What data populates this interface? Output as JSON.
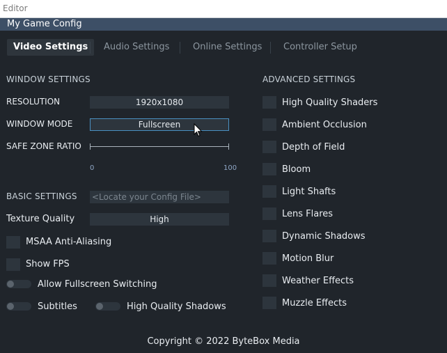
{
  "os_window": {
    "title": "Editor"
  },
  "app": {
    "title": "My Game Config"
  },
  "tabs": [
    {
      "label": "Video Settings",
      "active": true
    },
    {
      "label": "Audio Settings",
      "active": false
    },
    {
      "label": "Online Settings",
      "active": false
    },
    {
      "label": "Controller Setup",
      "active": false
    }
  ],
  "window_settings": {
    "title": "WINDOW SETTINGS",
    "resolution": {
      "label": "RESOLUTION",
      "value": "1920x1080"
    },
    "window_mode": {
      "label": "WINDOW MODE",
      "value": "Fullscreen"
    },
    "safe_zone": {
      "label": "SAFE ZONE RATIO",
      "min": "0",
      "max": "100"
    }
  },
  "basic_settings": {
    "title": "BASIC SETTINGS",
    "config_path_placeholder": "<Locate your Config File>",
    "texture_quality": {
      "label": "Texture Quality",
      "value": "High"
    },
    "checkboxes": [
      {
        "label": "MSAA Anti-Aliasing",
        "checked": false
      },
      {
        "label": "Show FPS",
        "checked": false
      }
    ],
    "toggles": [
      {
        "label": "Allow Fullscreen Switching",
        "on": false
      },
      {
        "label": "Subtitles",
        "on": false
      },
      {
        "label": "High Quality Shadows",
        "on": false
      }
    ]
  },
  "advanced_settings": {
    "title": "ADVANCED SETTINGS",
    "items": [
      {
        "label": "High Quality Shaders",
        "checked": false
      },
      {
        "label": "Ambient Occlusion",
        "checked": false
      },
      {
        "label": "Depth of Field",
        "checked": false
      },
      {
        "label": "Bloom",
        "checked": false
      },
      {
        "label": "Light Shafts",
        "checked": false
      },
      {
        "label": "Lens Flares",
        "checked": false
      },
      {
        "label": "Dynamic Shadows",
        "checked": false
      },
      {
        "label": "Motion Blur",
        "checked": false
      },
      {
        "label": "Weather Effects",
        "checked": false
      },
      {
        "label": "Muzzle Effects",
        "checked": false
      }
    ]
  },
  "footer": {
    "copyright": "Copyright © 2022 ByteBox Media"
  },
  "colors": {
    "background": "#20252b",
    "header": "#3d4f66",
    "field": "#2d353d",
    "accent": "#4a90c2"
  }
}
